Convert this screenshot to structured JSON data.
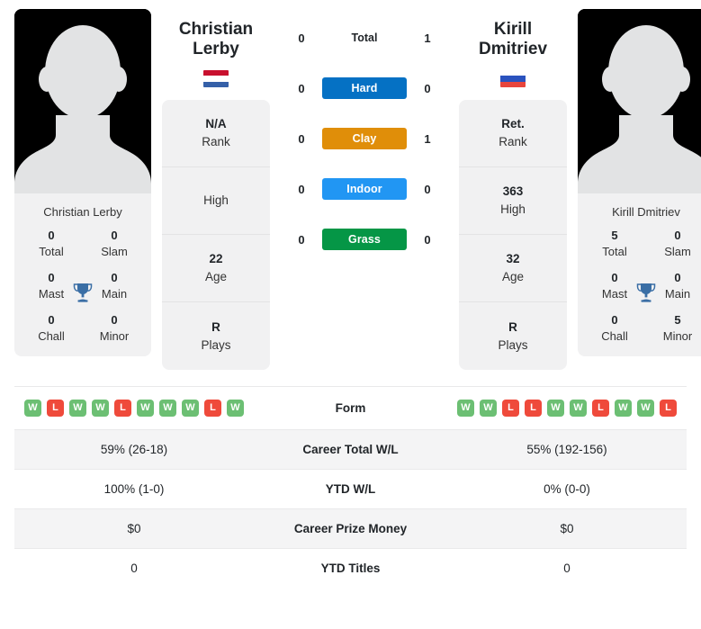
{
  "players": {
    "left": {
      "first_name": "Christian",
      "last_name": "Lerby",
      "full_name": "Christian Lerby",
      "flag": {
        "name": "netherlands-flag",
        "stripes": [
          "#c8102e",
          "#ffffff",
          "#3560a8"
        ]
      },
      "titles": [
        {
          "value": "0",
          "label": "Total"
        },
        {
          "value": "0",
          "label": "Slam"
        },
        {
          "value": "0",
          "label": "Mast"
        },
        {
          "value": "0",
          "label": "Main"
        },
        {
          "value": "0",
          "label": "Chall"
        },
        {
          "value": "0",
          "label": "Minor"
        }
      ],
      "info": [
        {
          "value": "N/A",
          "label": "Rank"
        },
        {
          "value": "",
          "label": "High"
        },
        {
          "value": "22",
          "label": "Age"
        },
        {
          "value": "R",
          "label": "Plays"
        }
      ],
      "form": [
        "W",
        "L",
        "W",
        "W",
        "L",
        "W",
        "W",
        "W",
        "L",
        "W"
      ],
      "career_total_wl": "59% (26-18)",
      "ytd_wl": "100% (1-0)",
      "career_prize_money": "$0",
      "ytd_titles": "0"
    },
    "right": {
      "first_name": "Kirill",
      "last_name": "Dmitriev",
      "full_name": "Kirill Dmitriev",
      "flag": {
        "name": "russia-flag",
        "stripes": [
          "#ffffff",
          "#2a52be",
          "#e8453c"
        ]
      },
      "titles": [
        {
          "value": "5",
          "label": "Total"
        },
        {
          "value": "0",
          "label": "Slam"
        },
        {
          "value": "0",
          "label": "Mast"
        },
        {
          "value": "0",
          "label": "Main"
        },
        {
          "value": "0",
          "label": "Chall"
        },
        {
          "value": "5",
          "label": "Minor"
        }
      ],
      "info": [
        {
          "value": "Ret.",
          "label": "Rank"
        },
        {
          "value": "363",
          "label": "High"
        },
        {
          "value": "32",
          "label": "Age"
        },
        {
          "value": "R",
          "label": "Plays"
        }
      ],
      "form": [
        "W",
        "W",
        "L",
        "L",
        "W",
        "W",
        "L",
        "W",
        "W",
        "L"
      ],
      "career_total_wl": "55% (192-156)",
      "ytd_wl": "0% (0-0)",
      "career_prize_money": "$0",
      "ytd_titles": "0"
    }
  },
  "head_to_head": [
    {
      "label": "Total",
      "left": "0",
      "right": "1",
      "badge": false,
      "color": ""
    },
    {
      "label": "Hard",
      "left": "0",
      "right": "0",
      "badge": true,
      "color": "#0571c4"
    },
    {
      "label": "Clay",
      "left": "0",
      "right": "1",
      "badge": true,
      "color": "#e08e09"
    },
    {
      "label": "Indoor",
      "left": "0",
      "right": "0",
      "badge": true,
      "color": "#2196f3"
    },
    {
      "label": "Grass",
      "left": "0",
      "right": "0",
      "badge": true,
      "color": "#059646"
    }
  ],
  "table": {
    "rows": [
      {
        "label": "Form",
        "left_type": "form"
      },
      {
        "label": "Career Total W/L",
        "left": "59% (26-18)",
        "right": "55% (192-156)"
      },
      {
        "label": "YTD W/L",
        "left": "100% (1-0)",
        "right": "0% (0-0)"
      },
      {
        "label": "Career Prize Money",
        "left": "$0",
        "right": "$0"
      },
      {
        "label": "YTD Titles",
        "left": "0",
        "right": "0"
      }
    ]
  },
  "colors": {
    "card_bg": "#f1f1f2",
    "win": "#6cbf73",
    "loss": "#ef4a3b",
    "trophy": "#3a6ea5"
  }
}
